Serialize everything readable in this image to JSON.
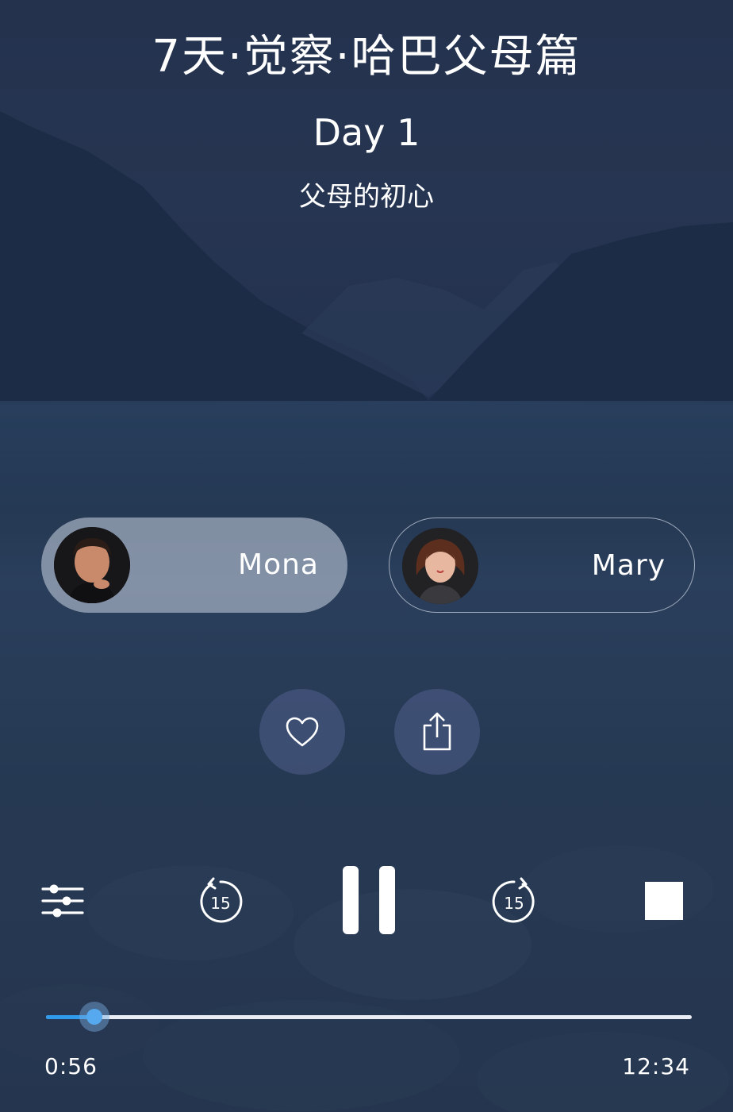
{
  "header": {
    "title": "7天·觉察·哈巴父母篇",
    "day": "Day 1",
    "subtitle": "父母的初心"
  },
  "speakers": [
    {
      "name": "Mona",
      "selected": true
    },
    {
      "name": "Mary",
      "selected": false
    }
  ],
  "actions": {
    "like_icon": "heart-icon",
    "share_icon": "share-icon"
  },
  "controls": {
    "settings_icon": "sliders-icon",
    "rewind": {
      "icon": "rewind-icon",
      "seconds": "15"
    },
    "play_pause_icon": "pause-icon",
    "forward": {
      "icon": "forward-icon",
      "seconds": "15"
    },
    "stop_icon": "stop-icon"
  },
  "playback": {
    "elapsed": "0:56",
    "total": "12:34",
    "progress_fraction": 0.075
  },
  "colors": {
    "accent": "#2f9bea",
    "background": "#24324e"
  }
}
